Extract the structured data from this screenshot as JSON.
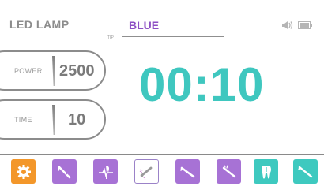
{
  "header": {
    "mode_title": "LED LAMP",
    "tip_label": "TIP",
    "color_value": "BLUE"
  },
  "status_icons": [
    "speaker-icon",
    "battery-icon"
  ],
  "settings": {
    "power_label": "POWER",
    "power_value": "2500",
    "time_label": "TIME",
    "time_value": "10"
  },
  "timer": {
    "display": "00:10"
  },
  "toolbar": {
    "buttons": [
      {
        "name": "settings-button",
        "icon": "gear-icon",
        "color": "#f3972a",
        "active": false
      },
      {
        "name": "scaler-button",
        "icon": "handpiece-icon",
        "color": "#a772d5",
        "active": false
      },
      {
        "name": "apex-locator-button",
        "icon": "tooth-wave-icon",
        "color": "#a772d5",
        "active": false
      },
      {
        "name": "led-lamp-button",
        "icon": "curing-light-icon",
        "color": "#ffffff",
        "active": true
      },
      {
        "name": "perio-button",
        "icon": "handpiece-icon",
        "color": "#a772d5",
        "active": false
      },
      {
        "name": "endo-button",
        "icon": "file-icon",
        "color": "#a772d5",
        "active": false
      },
      {
        "name": "tooth-button",
        "icon": "tooth-icon",
        "color": "#3ec9bf",
        "active": false
      },
      {
        "name": "surgery-button",
        "icon": "scalpel-icon",
        "color": "#3ec9bf",
        "active": false
      }
    ]
  },
  "colors": {
    "accent_teal": "#3fc7bf",
    "accent_purple": "#8d4fc4",
    "accent_orange": "#f3972a",
    "text_gray": "#8c8c8c"
  }
}
